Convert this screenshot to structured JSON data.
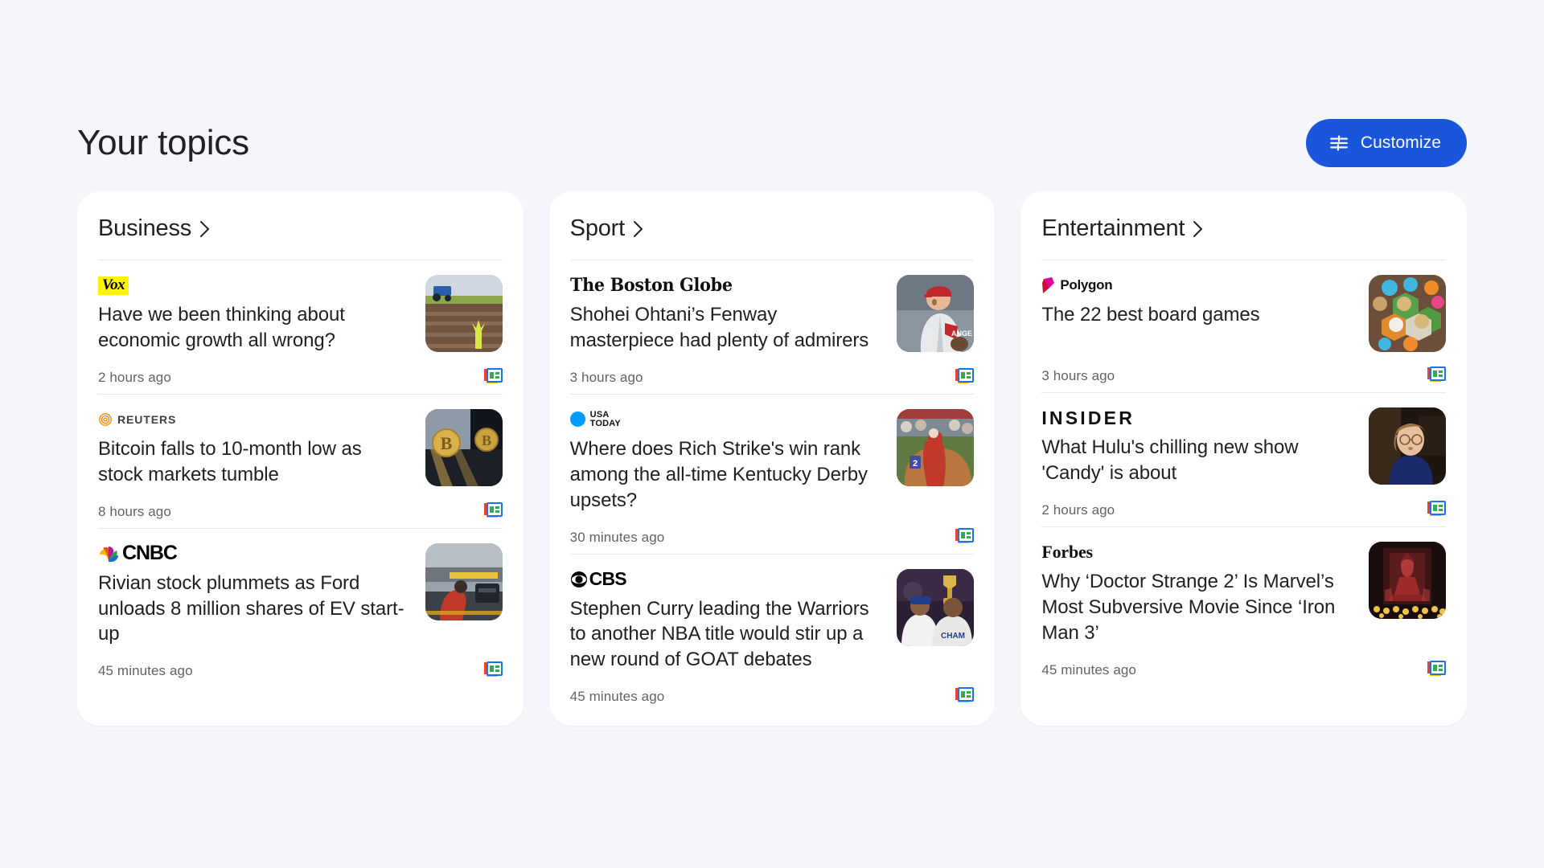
{
  "header": {
    "title": "Your topics",
    "customize_label": "Customize",
    "customize_icon": "tune-icon",
    "accent_color": "#1a56db"
  },
  "page": {
    "background_color": "#f4f6fb",
    "card_background_color": "#ffffff",
    "text_color": "#202124",
    "muted_text_color": "#5f6368"
  },
  "columns": [
    {
      "topic": "Business",
      "chevron_icon": "chevron-right-icon",
      "articles": [
        {
          "source": "Vox",
          "source_style": "vox",
          "headline": "Have we been thinking about economic growth all wrong?",
          "timestamp": "2 hours ago",
          "badge_icon": "google-news-icon",
          "thumbnail": "tractor-field-seedling"
        },
        {
          "source": "REUTERS",
          "source_style": "reuters",
          "headline": "Bitcoin falls to 10-month low as stock markets tumble",
          "timestamp": "8 hours ago",
          "badge_icon": "google-news-icon",
          "thumbnail": "bitcoin-coins-keyboard"
        },
        {
          "source": "CNBC",
          "source_style": "cnbc",
          "headline": "Rivian stock plummets as Ford unloads 8 million shares of EV start-up",
          "timestamp": "45 minutes ago",
          "badge_icon": "google-news-icon",
          "thumbnail": "factory-worker-assembly-line"
        }
      ]
    },
    {
      "topic": "Sport",
      "chevron_icon": "chevron-right-icon",
      "articles": [
        {
          "source": "The Boston Globe",
          "source_style": "globe",
          "headline": "Shohei Ohtani’s Fenway masterpiece had plenty of admirers",
          "timestamp": "3 hours ago",
          "badge_icon": "google-news-icon",
          "thumbnail": "baseball-pitcher-angels"
        },
        {
          "source": "USA TODAY",
          "source_style": "usatoday",
          "headline": "Where does Rich Strike's win rank among the all-time Kentucky Derby upsets?",
          "timestamp": "30 minutes ago",
          "badge_icon": "google-news-icon",
          "thumbnail": "derby-horse-rose-garland"
        },
        {
          "source": "CBS",
          "source_style": "cbs",
          "headline": "Stephen Curry leading the Warriors to another NBA title would stir up a new round of GOAT debates",
          "timestamp": "45 minutes ago",
          "badge_icon": "google-news-icon",
          "thumbnail": "warriors-trophy-celebration"
        }
      ]
    },
    {
      "topic": "Entertainment",
      "chevron_icon": "chevron-right-icon",
      "articles": [
        {
          "source": "Polygon",
          "source_style": "polygon",
          "headline": "The 22 best board games",
          "timestamp": "3 hours ago",
          "badge_icon": "google-news-icon",
          "thumbnail": "catan-board-game-pieces"
        },
        {
          "source": "INSIDER",
          "source_style": "insider",
          "headline": "What Hulu's chilling new show 'Candy' is about",
          "timestamp": "2 hours ago",
          "badge_icon": "google-news-icon",
          "thumbnail": "candy-show-woman-glasses"
        },
        {
          "source": "Forbes",
          "source_style": "forbes",
          "headline": "Why ‘Doctor Strange 2’ Is Marvel’s Most Subversive Movie Since ‘Iron Man 3’",
          "timestamp": "45 minutes ago",
          "badge_icon": "google-news-icon",
          "thumbnail": "scarlet-witch-candles"
        }
      ]
    }
  ],
  "logo_text": {
    "usatoday_line1": "USA",
    "usatoday_line2": "TODAY"
  }
}
